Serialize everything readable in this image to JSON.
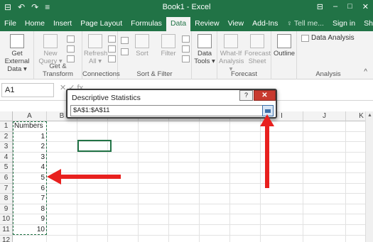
{
  "window": {
    "title": "Book1 - Excel",
    "qat": [
      "⊟",
      "↶",
      "↷",
      "≡"
    ],
    "controls": [
      "⊟",
      "–",
      "□",
      "✕"
    ]
  },
  "tabs": [
    {
      "label": "File"
    },
    {
      "label": "Home"
    },
    {
      "label": "Insert"
    },
    {
      "label": "Page Layout"
    },
    {
      "label": "Formulas"
    },
    {
      "label": "Data"
    },
    {
      "label": "Review"
    },
    {
      "label": "View"
    },
    {
      "label": "Add-Ins"
    },
    {
      "label": "♀ Tell me..."
    }
  ],
  "account": {
    "signin": "Sign in",
    "share": "Share"
  },
  "ribbon": {
    "get_external": "Get External Data ▾",
    "new_query": "New Query ▾",
    "refresh_all": "Refresh All ▾",
    "sort": "Sort",
    "filter": "Filter",
    "data_tools": "Data Tools ▾",
    "what_if": "What-If Analysis ▾",
    "forecast_sheet": "Forecast Sheet",
    "outline": "Outline",
    "data_analysis": "Data Analysis",
    "groups": {
      "get_transform": "Get & Transform",
      "connections": "Connections",
      "sort_filter": "Sort & Filter",
      "forecast": "Forecast",
      "analysis": "Analysis"
    }
  },
  "formula_bar": {
    "name_box": "A1",
    "fx": "✕  ✓  fx"
  },
  "columns": [
    "A",
    "B",
    "C",
    "D",
    "E",
    "F",
    "G",
    "H",
    "I",
    "J",
    "K"
  ],
  "rows": [
    "1",
    "2",
    "3",
    "4",
    "5",
    "6",
    "7",
    "8",
    "9",
    "10",
    "11",
    "12"
  ],
  "cells": {
    "a1": "Numbers",
    "values": [
      "1",
      "2",
      "3",
      "4",
      "5",
      "6",
      "7",
      "8",
      "9",
      "10"
    ]
  },
  "dialog": {
    "title": "Descriptive Statistics",
    "help": "?",
    "close": "✕",
    "range_value": "$A$1:$A$11"
  },
  "colors": {
    "excel_green": "#217346",
    "arrow_red": "#e8201e"
  }
}
